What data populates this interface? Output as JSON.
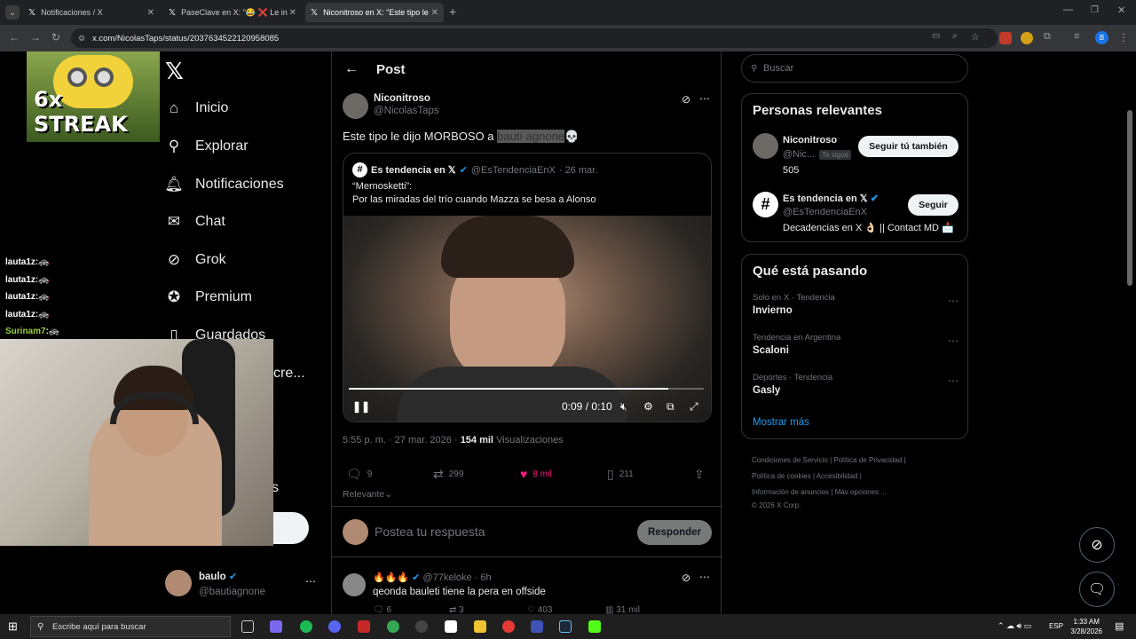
{
  "browser": {
    "tabs": [
      {
        "label": "Notificaciones / X"
      },
      {
        "label": "PaseClave en X: \"😂 ❌ Le inter"
      },
      {
        "label": "Niconitroso en X: \"Este tipo le d"
      }
    ],
    "url": "x.com/NicolasTaps/status/2037634522120958085",
    "account_initial": "B"
  },
  "overlay": {
    "streak_text": "6x STREAK",
    "chat": [
      {
        "user": "lauta1z",
        "color": "#ffffff",
        "emote": "🚓"
      },
      {
        "user": "lauta1z",
        "color": "#ffffff",
        "emote": "🚓"
      },
      {
        "user": "lauta1z",
        "color": "#ffffff",
        "emote": "🚓"
      },
      {
        "user": "lauta1z",
        "color": "#ffffff",
        "emote": "🚓"
      },
      {
        "user": "Surinam7",
        "color": "#9acd32",
        "emote": "🚓"
      }
    ]
  },
  "nav": {
    "items": [
      {
        "label": "Inicio",
        "icon": "home-icon"
      },
      {
        "label": "Explorar",
        "icon": "search-icon"
      },
      {
        "label": "Notificaciones",
        "icon": "bell-icon"
      },
      {
        "label": "Chat",
        "icon": "mail-icon"
      },
      {
        "label": "Grok",
        "icon": "grok-icon"
      },
      {
        "label": "Premium",
        "icon": "verified-icon"
      },
      {
        "label": "Guardados",
        "icon": "bookmark-icon"
      }
    ],
    "partial_more": "cre...",
    "partial_s": "s",
    "profile": {
      "name": "baulo",
      "handle": "@bautiagnone"
    }
  },
  "post": {
    "header_title": "Post",
    "author_name": "Niconitroso",
    "author_handle": "@NicolasTaps",
    "text_before": "Este tipo le dijo MORBOSO a ",
    "text_highlight": "bautí agnone",
    "text_emoji": "💀",
    "quote": {
      "author_name": "Es tendencia en 𝕏",
      "author_handle": "@EsTendenciaEnX",
      "date": "· 26 mar.",
      "line1": "“Mernosketti”:",
      "line2": "Por las miradas del trío cuando Mazza se besa a Alonso",
      "video_time": "0:09 / 0:10",
      "progress": 0.9
    },
    "time": "5:55 p. m. · 27 mar. 2026 ·",
    "views_count": "154 mil",
    "views_label": "Visualizaciones",
    "replies": "9",
    "reposts": "299",
    "likes": "8 mil",
    "bookmarks": "211",
    "sort_label": "Relevante",
    "reply_placeholder": "Postea tu respuesta",
    "reply_button": "Responder"
  },
  "comment": {
    "name": "🔥🔥🔥",
    "handle": "@77keloke · 6h",
    "text": "qeonda bauleti tiene la pera en offside",
    "replies": "6",
    "reposts": "3",
    "likes": "403",
    "views": "31 mil"
  },
  "sidebar": {
    "search_placeholder": "Buscar",
    "relevant_title": "Personas relevantes",
    "people": [
      {
        "name": "Niconitroso",
        "handle": "@Nic...",
        "badge": "Te sigue",
        "bio": "505",
        "button": "Seguir tú también"
      },
      {
        "name": "Es tendencia en 𝕏",
        "handle": "@EsTendenciaEnX",
        "bio": "Decadencias en X 👌🏻 || Contact MD 📩",
        "button": "Seguir"
      }
    ],
    "trending_title": "Qué está pasando",
    "trends": [
      {
        "context": "Solo en X · Tendencia",
        "title": "Invierno"
      },
      {
        "context": "Tendencia en Argentina",
        "title": "Scaloni"
      },
      {
        "context": "Deportes · Tendencia",
        "title": "Gasly"
      }
    ],
    "show_more": "Mostrar más",
    "footer": [
      "Condiciones de Servicio",
      "Política de Privacidad",
      "Política de cookies",
      "Accesibilidad",
      "Información de anuncios",
      "Más opciones ...",
      "© 2026 X Corp."
    ]
  },
  "taskbar": {
    "search_placeholder": "Escribe aquí para buscar",
    "lang": "ESP",
    "time": "1:33 AM",
    "date": "3/28/2026"
  }
}
